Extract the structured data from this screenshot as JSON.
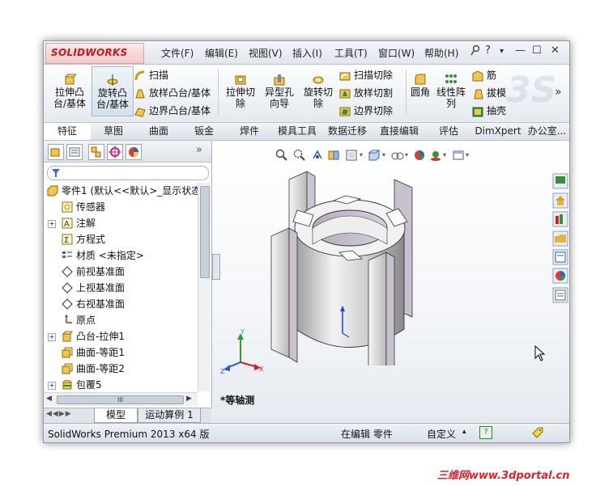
{
  "app": {
    "logo": "SOLIDWORKS"
  },
  "menu": {
    "items": [
      "文件(F)",
      "编辑(E)",
      "视图(V)",
      "插入(I)",
      "工具(T)",
      "窗口(W)",
      "帮助(H)"
    ],
    "window_controls": {
      "help": "?",
      "dropdown": "▾",
      "minimize": "—",
      "restore": "☐",
      "close": "✕"
    }
  },
  "commands": {
    "extrude_boss": "拉伸凸\n台/基体",
    "revolve_boss": "旋转凸\n台/基体",
    "sweep": "扫描",
    "loft_boss": "放样凸台/基体",
    "boundary_boss": "边界凸台/基体",
    "extrude_cut": "拉伸切\n除",
    "hole_wizard": "异型孔\n向导",
    "revolve_cut": "旋转切\n除",
    "swept_cut": "扫描切除",
    "lofted_cut": "放样切割",
    "boundary_cut": "边界切除",
    "fillet": "圆角",
    "linear_pattern": "线性阵\n列",
    "rib": "筋",
    "draft": "拔模",
    "shell": "抽壳",
    "more": "»"
  },
  "tabs": [
    "特征",
    "草图",
    "曲面",
    "钣金",
    "焊件",
    "模具工具",
    "数据迁移",
    "直接编辑",
    "评估",
    "DimXpert",
    "办公室..."
  ],
  "active_tab": "特征",
  "panel": {
    "more": "»",
    "filter_icon": "filter-icon",
    "tree": [
      {
        "label": "零件1  (默认<<默认>_显示状态",
        "icon": "part-icon",
        "expander": ""
      },
      {
        "label": "传感器",
        "icon": "sensor-icon",
        "expander": ""
      },
      {
        "label": "注解",
        "icon": "annotation-icon",
        "expander": "+"
      },
      {
        "label": "方程式",
        "icon": "equation-icon",
        "expander": ""
      },
      {
        "label": "材质 <未指定>",
        "icon": "material-icon",
        "expander": ""
      },
      {
        "label": "前视基准面",
        "icon": "plane-icon",
        "expander": ""
      },
      {
        "label": "上视基准面",
        "icon": "plane-icon",
        "expander": ""
      },
      {
        "label": "右视基准面",
        "icon": "plane-icon",
        "expander": ""
      },
      {
        "label": "原点",
        "icon": "origin-icon",
        "expander": ""
      },
      {
        "label": "凸台-拉伸1",
        "icon": "extrude-icon",
        "expander": "+"
      },
      {
        "label": "曲面-等距1",
        "icon": "surface-icon",
        "expander": ""
      },
      {
        "label": "曲面-等距2",
        "icon": "surface-icon",
        "expander": ""
      },
      {
        "label": "包覆5",
        "icon": "wrap-icon",
        "expander": "+"
      }
    ],
    "hscroll_thumb": "III"
  },
  "bottom_tabs": [
    "模型",
    "运动算例 1"
  ],
  "view_label": "*等轴测",
  "triad": {
    "x": "X",
    "y": "Y",
    "z": "Z"
  },
  "status": {
    "product": "SolidWorks Premium 2013 x64 版",
    "editing": "在编辑 零件",
    "units": "自定义",
    "units_caret": "▴",
    "help": "?"
  },
  "watermark": "三维网www.3dportal.cn",
  "colors": {
    "brand_red": "#c8171d",
    "part_face": "#c9c1cf",
    "part_body": "#d8d8d8"
  }
}
